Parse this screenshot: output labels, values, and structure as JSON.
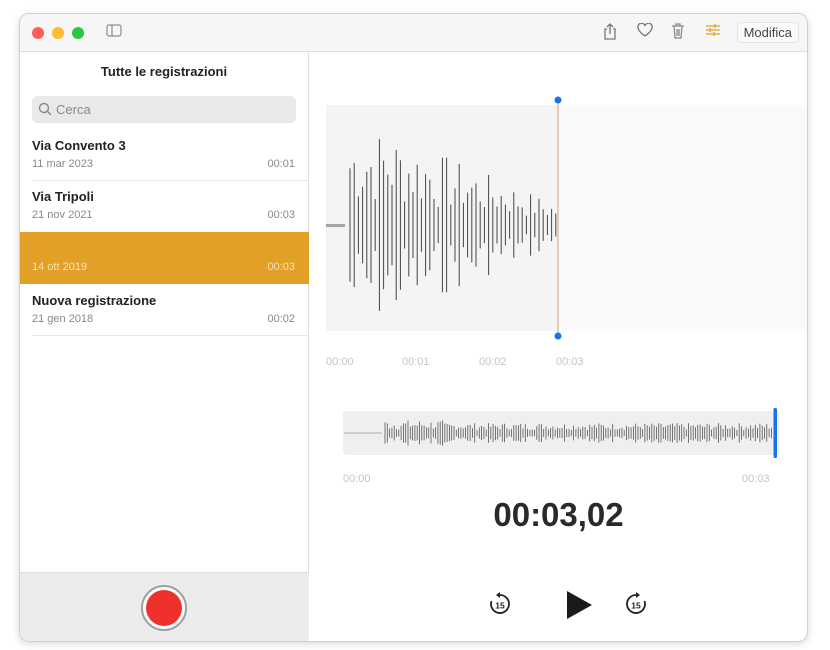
{
  "toolbar": {
    "edit_label": "Modifica",
    "icons": [
      "sidebar-toggle-icon",
      "share-icon",
      "heart-icon",
      "trash-icon",
      "settings-sliders-icon"
    ]
  },
  "sidebar": {
    "title": "Tutte le registrazioni",
    "search_placeholder": "Cerca",
    "items": [
      {
        "name": "Via Convento 3",
        "date": "11 mar 2023",
        "duration": "00:01"
      },
      {
        "name": "Via Tripoli",
        "date": "21 nov 2021",
        "duration": "00:03"
      },
      {
        "name": "",
        "date": "14 ott 2019",
        "duration": "00:03",
        "selected": true
      },
      {
        "name": "Nuova registrazione",
        "date": "21 gen 2018",
        "duration": "00:02"
      }
    ]
  },
  "player": {
    "detail_ticks": [
      "00:00",
      "00:01",
      "00:02",
      "00:03"
    ],
    "overview_start": "00:00",
    "overview_end": "00:03",
    "current_time": "00:03,02",
    "skip_seconds": "15",
    "progress": 1.0
  },
  "colors": {
    "accent": "#e2a027",
    "record": "#f0302a",
    "playhead": "#1a73e8"
  }
}
